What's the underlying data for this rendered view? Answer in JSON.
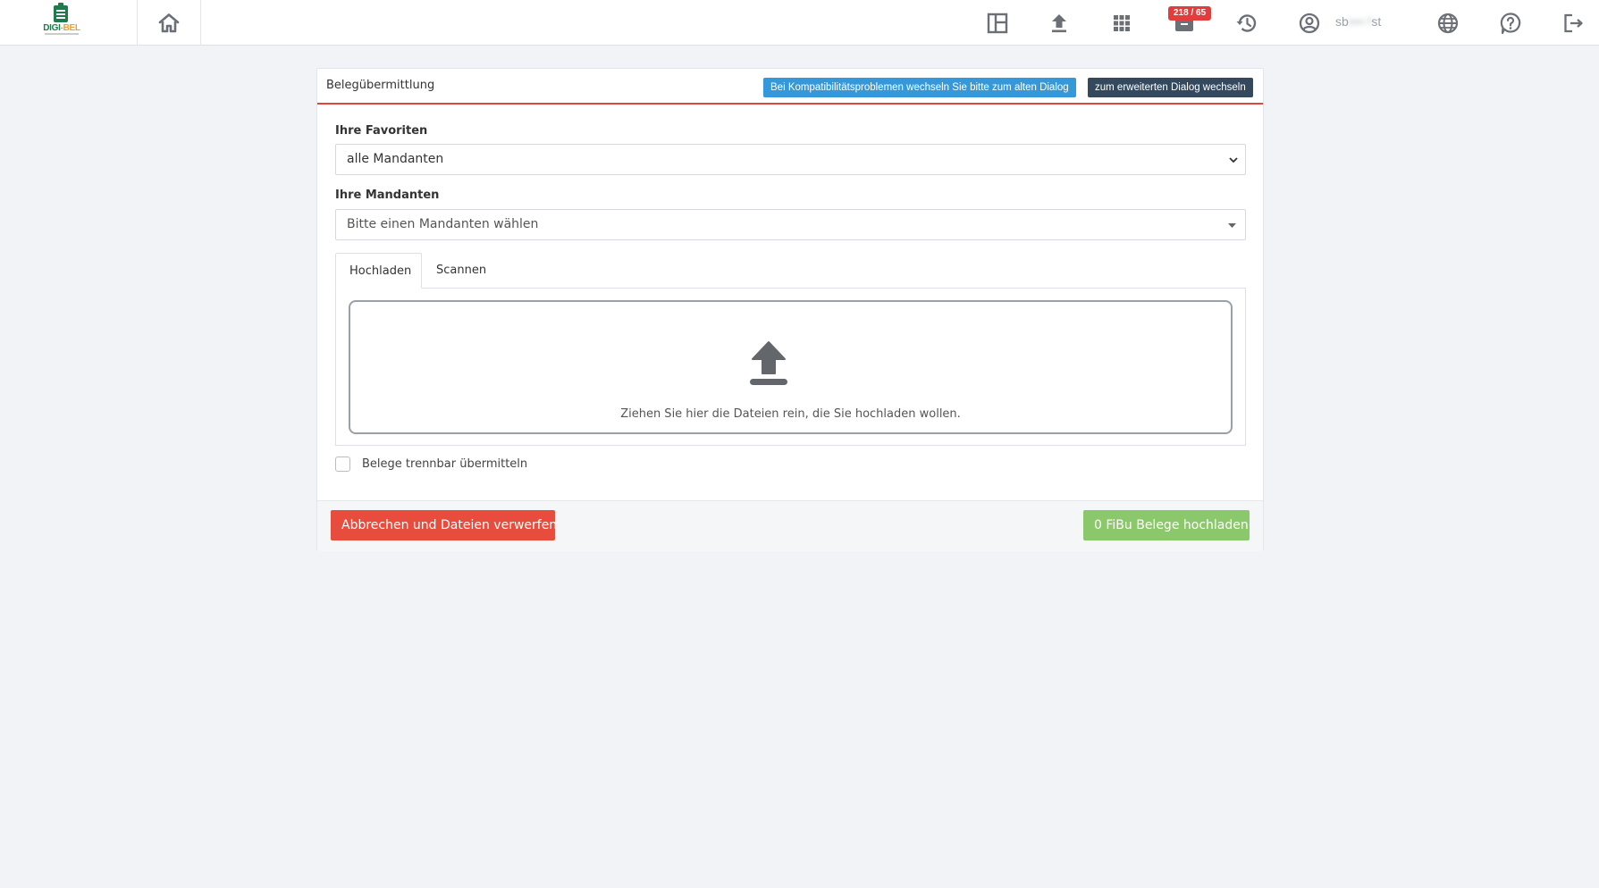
{
  "nav": {
    "logo_text_part1": "DIGI",
    "logo_text_part2": "-BEL",
    "badge": "218 / 65",
    "username_part1": "sb",
    "username_hidden": "i••• f",
    "username_part2": "st",
    "icons": [
      "home-icon",
      "dashboard-icon",
      "upload-icon",
      "apps-grid-icon",
      "inbox-icon",
      "history-icon",
      "user-circle-icon",
      "globe-icon",
      "help-icon",
      "logout-icon"
    ]
  },
  "card": {
    "title": "Belegübermittlung",
    "compat_button": "Bei Kompatibilitätsproblemen wechseln Sie bitte zum alten Dialog",
    "extended_button": "zum erweiterten Dialog wechseln",
    "favorites_label": "Ihre Favoriten",
    "favorites_value": "alle Mandanten",
    "clients_label": "Ihre Mandanten",
    "clients_placeholder": "Bitte einen Mandanten wählen",
    "tabs": [
      {
        "label": "Hochladen",
        "active": true
      },
      {
        "label": "Scannen",
        "active": false
      }
    ],
    "dropzone_text": "Ziehen Sie hier die Dateien rein, die Sie hochladen wollen.",
    "separable_checkbox_label": "Belege trennbar übermitteln",
    "cancel_button": "Abbrechen und Dateien verwerfen",
    "upload_button": "0 FiBu Belege hochladen"
  },
  "colors": {
    "accent_red": "#e0463a",
    "info_blue": "#3498db",
    "dark": "#34495e",
    "danger": "#e74c3c",
    "success": "#8bc76b",
    "badge_red": "#e23c3c",
    "icon_gray": "#6b6f76"
  }
}
